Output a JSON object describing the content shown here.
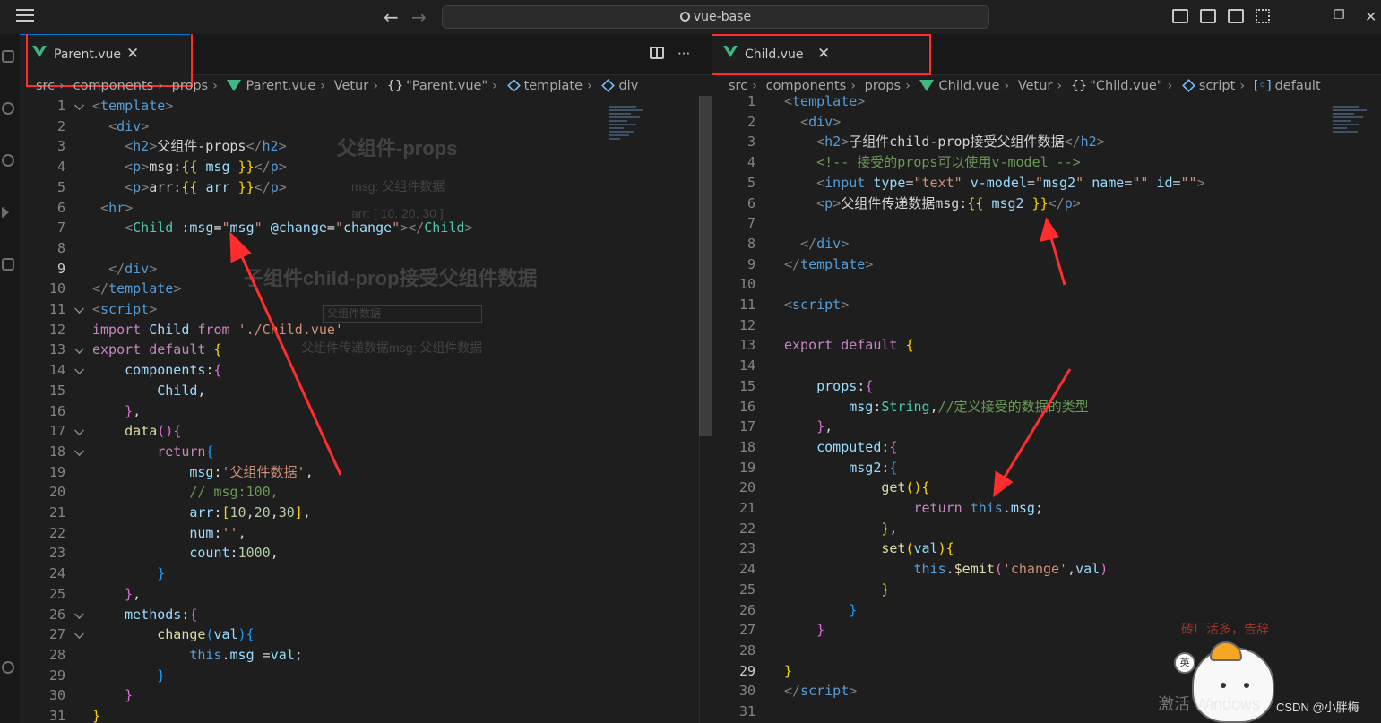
{
  "titlebar": {
    "search_text": "vue-base"
  },
  "left_editor": {
    "tab_label": "Parent.vue",
    "breadcrumb": [
      "src",
      "components",
      "props",
      "Parent.vue",
      "Vetur",
      "\"Parent.vue\"",
      "template",
      "div"
    ],
    "lines": [
      {
        "n": "1",
        "fold": true,
        "html": "<span class='g'>&lt;</span><span class='t'>template</span><span class='g'>&gt;</span>"
      },
      {
        "n": "2",
        "fold": false,
        "html": "  <span class='g'>&lt;</span><span class='t'>div</span><span class='g'>&gt;</span>"
      },
      {
        "n": "3",
        "fold": false,
        "html": "    <span class='g'>&lt;</span><span class='t'>h2</span><span class='g'>&gt;</span><span class='ch'>父组件-props</span><span class='g'>&lt;/</span><span class='t'>h2</span><span class='g'>&gt;</span>"
      },
      {
        "n": "4",
        "fold": false,
        "html": "    <span class='g'>&lt;</span><span class='t'>p</span><span class='g'>&gt;</span><span class='ch'>msg:</span><span class='b1'>{{</span> <span class='a'>msg</span> <span class='b1'>}}</span><span class='g'>&lt;/</span><span class='t'>p</span><span class='g'>&gt;</span>"
      },
      {
        "n": "5",
        "fold": false,
        "html": "    <span class='g'>&lt;</span><span class='t'>p</span><span class='g'>&gt;</span><span class='ch'>arr:</span><span class='b1'>{{</span> <span class='a'>arr</span> <span class='b1'>}}</span><span class='g'>&lt;/</span><span class='t'>p</span><span class='g'>&gt;</span>"
      },
      {
        "n": "6",
        "fold": false,
        "html": " <span class='g'>&lt;</span><span class='t'>hr</span><span class='g'>&gt;</span>"
      },
      {
        "n": "7",
        "fold": false,
        "html": "    <span class='g'>&lt;</span><span class='y'>Child</span> <span class='a'>:msg</span><span class='p'>=</span><span class='s'>\"</span><span class='a'>msg</span><span class='s'>\"</span> <span class='a'>@change</span><span class='p'>=</span><span class='s'>\"</span><span class='a'>change</span><span class='s'>\"</span><span class='g'>&gt;&lt;/</span><span class='y'>Child</span><span class='g'>&gt;</span>"
      },
      {
        "n": "8",
        "fold": false,
        "html": ""
      },
      {
        "n": "9",
        "fold": false,
        "cur": true,
        "html": "  <span class='g'>&lt;/</span><span class='t'>div</span><span class='g'>&gt;</span>"
      },
      {
        "n": "10",
        "fold": false,
        "html": "<span class='g'>&lt;/</span><span class='t'>template</span><span class='g'>&gt;</span>"
      },
      {
        "n": "11",
        "fold": true,
        "html": "<span class='g'>&lt;</span><span class='t'>script</span><span class='g'>&gt;</span>"
      },
      {
        "n": "12",
        "fold": false,
        "html": "<span class='k'>import</span> <span class='a'>Child</span> <span class='k'>from</span> <span class='s'>'./Child.vue'</span>"
      },
      {
        "n": "13",
        "fold": true,
        "html": "<span class='k'>export</span> <span class='k'>default</span> <span class='b1'>{</span>"
      },
      {
        "n": "14",
        "fold": true,
        "html": "    <span class='a'>components</span><span class='p'>:</span><span class='b2'>{</span>"
      },
      {
        "n": "15",
        "fold": false,
        "html": "        <span class='a'>Child</span><span class='p'>,</span>"
      },
      {
        "n": "16",
        "fold": false,
        "html": "    <span class='b2'>}</span><span class='p'>,</span>"
      },
      {
        "n": "17",
        "fold": true,
        "html": "    <span class='f'>data</span><span class='b2'>()</span><span class='b2'>{</span>"
      },
      {
        "n": "18",
        "fold": true,
        "html": "        <span class='k'>return</span><span class='b3'>{</span>"
      },
      {
        "n": "19",
        "fold": false,
        "html": "            <span class='a'>msg</span><span class='p'>:</span><span class='s'>'父组件数据'</span><span class='p'>,</span>"
      },
      {
        "n": "20",
        "fold": false,
        "html": "            <span class='c'>// msg:100,</span>"
      },
      {
        "n": "21",
        "fold": false,
        "html": "            <span class='a'>arr</span><span class='p'>:</span><span class='b1'>[</span><span class='n'>10</span><span class='p'>,</span><span class='n'>20</span><span class='p'>,</span><span class='n'>30</span><span class='b1'>]</span><span class='p'>,</span>"
      },
      {
        "n": "22",
        "fold": false,
        "html": "            <span class='a'>num</span><span class='p'>:</span><span class='s'>''</span><span class='p'>,</span>"
      },
      {
        "n": "23",
        "fold": false,
        "html": "            <span class='a'>count</span><span class='p'>:</span><span class='n'>1000</span><span class='p'>,</span>"
      },
      {
        "n": "24",
        "fold": false,
        "html": "        <span class='b3'>}</span>"
      },
      {
        "n": "25",
        "fold": false,
        "html": "    <span class='b2'>}</span><span class='p'>,</span>"
      },
      {
        "n": "26",
        "fold": true,
        "html": "    <span class='a'>methods</span><span class='p'>:</span><span class='b2'>{</span>"
      },
      {
        "n": "27",
        "fold": true,
        "html": "        <span class='f'>change</span><span class='b3'>(</span><span class='a'>val</span><span class='b3'>)</span><span class='b3'>{</span>"
      },
      {
        "n": "28",
        "fold": false,
        "html": "            <span class='t'>this</span><span class='p'>.</span><span class='a'>msg</span> <span class='p'>=</span><span class='a'>val</span><span class='p'>;</span>"
      },
      {
        "n": "29",
        "fold": false,
        "html": "        <span class='b3'>}</span>"
      },
      {
        "n": "30",
        "fold": false,
        "html": "    <span class='b2'>}</span>"
      },
      {
        "n": "31",
        "fold": false,
        "html": "<span class='b1'>}</span>"
      }
    ],
    "ghost_preview": {
      "title": "父组件-props",
      "msg_line": "msg: 父组件数据",
      "arr_line": "arr: [ 10, 20, 30 ]",
      "child_title": "子组件child-prop接受父组件数据",
      "input_value": "父组件数据",
      "passed_line": "父组件传递数据msg: 父组件数据"
    }
  },
  "right_editor": {
    "tab_label": "Child.vue",
    "breadcrumb": [
      "src",
      "components",
      "props",
      "Child.vue",
      "Vetur",
      "\"Child.vue\"",
      "script",
      "default"
    ],
    "lines": [
      {
        "n": "1",
        "fold": false,
        "html": "<span class='g'>&lt;</span><span class='t'>template</span><span class='g'>&gt;</span>"
      },
      {
        "n": "2",
        "fold": false,
        "html": "  <span class='g'>&lt;</span><span class='t'>div</span><span class='g'>&gt;</span>"
      },
      {
        "n": "3",
        "fold": false,
        "html": "    <span class='g'>&lt;</span><span class='t'>h2</span><span class='g'>&gt;</span><span class='ch'>子组件child-prop接受父组件数据</span><span class='g'>&lt;/</span><span class='t'>h2</span><span class='g'>&gt;</span>"
      },
      {
        "n": "4",
        "fold": false,
        "html": "    <span class='c'>&lt;!-- 接受的props可以使用v-model --&gt;</span>"
      },
      {
        "n": "5",
        "fold": false,
        "html": "    <span class='g'>&lt;</span><span class='t'>input</span> <span class='a'>type</span><span class='p'>=</span><span class='s'>\"text\"</span> <span class='a'>v-model</span><span class='p'>=</span><span class='s'>\"</span><span class='a'>msg2</span><span class='s'>\"</span> <span class='a'>name</span><span class='p'>=</span><span class='s'>\"\"</span> <span class='a'>id</span><span class='p'>=</span><span class='s'>\"\"</span><span class='g'>&gt;</span>"
      },
      {
        "n": "6",
        "fold": false,
        "html": "    <span class='g'>&lt;</span><span class='t'>p</span><span class='g'>&gt;</span><span class='ch'>父组件传递数据msg:</span><span class='b1'>{{</span> <span class='a'>msg2</span> <span class='b1'>}}</span><span class='g'>&lt;/</span><span class='t'>p</span><span class='g'>&gt;</span>"
      },
      {
        "n": "7",
        "fold": false,
        "html": ""
      },
      {
        "n": "8",
        "fold": false,
        "html": "  <span class='g'>&lt;/</span><span class='t'>div</span><span class='g'>&gt;</span>"
      },
      {
        "n": "9",
        "fold": false,
        "html": "<span class='g'>&lt;/</span><span class='t'>template</span><span class='g'>&gt;</span>"
      },
      {
        "n": "10",
        "fold": false,
        "html": ""
      },
      {
        "n": "11",
        "fold": false,
        "html": "<span class='g'>&lt;</span><span class='t'>script</span><span class='g'>&gt;</span>"
      },
      {
        "n": "12",
        "fold": false,
        "html": ""
      },
      {
        "n": "13",
        "fold": false,
        "html": "<span class='k'>export</span> <span class='k'>default</span> <span class='b1'>{</span>"
      },
      {
        "n": "14",
        "fold": false,
        "html": ""
      },
      {
        "n": "15",
        "fold": false,
        "html": "    <span class='a'>props</span><span class='p'>:</span><span class='b2'>{</span>"
      },
      {
        "n": "16",
        "fold": false,
        "html": "        <span class='a'>msg</span><span class='p'>:</span><span class='y'>String</span><span class='p'>,</span><span class='c'>//定义接受的数据的类型</span>"
      },
      {
        "n": "17",
        "fold": false,
        "html": "    <span class='b2'>}</span><span class='p'>,</span>"
      },
      {
        "n": "18",
        "fold": false,
        "html": "    <span class='a'>computed</span><span class='p'>:</span><span class='b2'>{</span>"
      },
      {
        "n": "19",
        "fold": false,
        "html": "        <span class='a'>msg2</span><span class='p'>:</span><span class='b3'>{</span>"
      },
      {
        "n": "20",
        "fold": false,
        "html": "            <span class='f'>get</span><span class='b1'>()</span><span class='b1'>{</span>"
      },
      {
        "n": "21",
        "fold": false,
        "html": "                <span class='k'>return</span> <span class='t'>this</span><span class='p'>.</span><span class='a'>msg</span><span class='p'>;</span>"
      },
      {
        "n": "22",
        "fold": false,
        "html": "            <span class='b1'>}</span><span class='p'>,</span>"
      },
      {
        "n": "23",
        "fold": false,
        "html": "            <span class='f'>set</span><span class='b1'>(</span><span class='a'>val</span><span class='b1'>)</span><span class='b1'>{</span>"
      },
      {
        "n": "24",
        "fold": false,
        "html": "                <span class='t'>this</span><span class='p'>.</span><span class='f'>$emit</span><span class='b2'>(</span><span class='s'>'change'</span><span class='p'>,</span><span class='a'>val</span><span class='b2'>)</span>"
      },
      {
        "n": "25",
        "fold": false,
        "html": "            <span class='b1'>}</span>"
      },
      {
        "n": "26",
        "fold": false,
        "html": "        <span class='b3'>}</span>"
      },
      {
        "n": "27",
        "fold": false,
        "html": "    <span class='b2'>}</span>"
      },
      {
        "n": "28",
        "fold": false,
        "html": ""
      },
      {
        "n": "29",
        "fold": false,
        "cur": true,
        "html": "<span class='b1'>}</span>"
      },
      {
        "n": "30",
        "fold": false,
        "html": "<span class='g'>&lt;/</span><span class='t'>script</span><span class='g'>&gt;</span>"
      },
      {
        "n": "31",
        "fold": false,
        "html": ""
      }
    ]
  },
  "annotation_color": "#ff2d2d",
  "watermark": {
    "stamp": "砖厂活多，告辞",
    "credit": "CSDN @小胖梅",
    "badge": "英",
    "activate": "激活 Windows"
  }
}
